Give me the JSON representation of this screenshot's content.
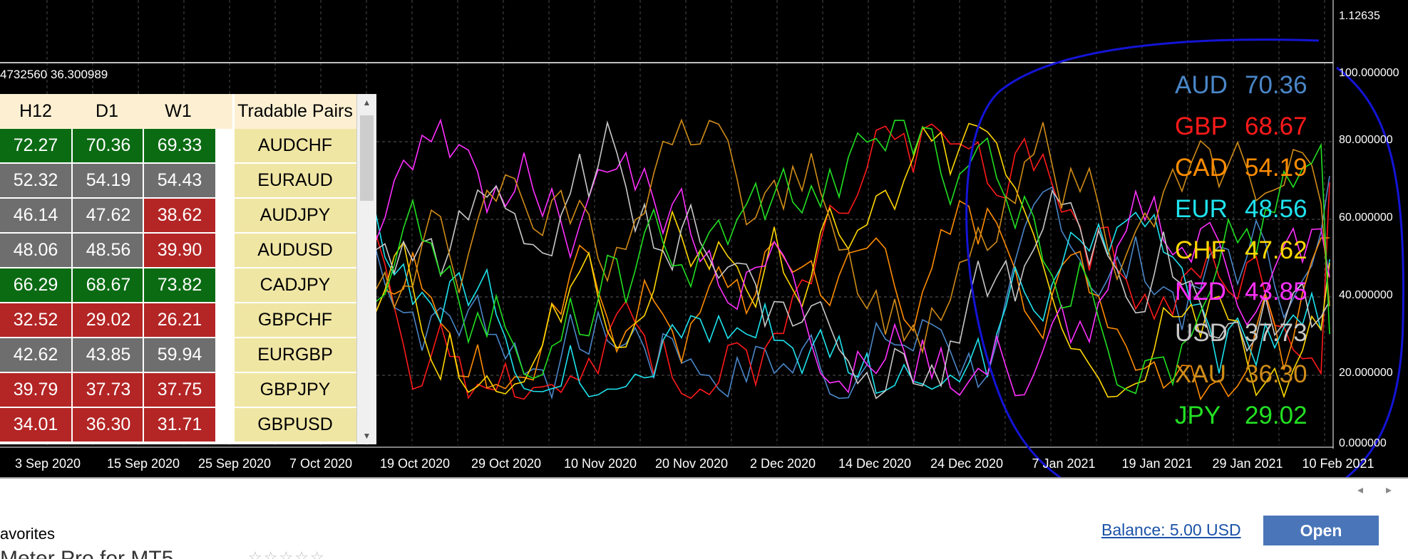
{
  "indicator_label": "4732560 36.300989",
  "table": {
    "headers": [
      "H12",
      "D1",
      "W1",
      "Tradable Pairs"
    ],
    "rows": [
      {
        "h12": "72.27",
        "d1": "70.36",
        "w1": "69.33",
        "pair": "AUDCHF",
        "colors": [
          "#0a6b13",
          "#0a6b13",
          "#0a6b13"
        ]
      },
      {
        "h12": "52.32",
        "d1": "54.19",
        "w1": "54.43",
        "pair": "EURAUD",
        "colors": [
          "#6e6e6e",
          "#6e6e6e",
          "#6e6e6e"
        ]
      },
      {
        "h12": "46.14",
        "d1": "47.62",
        "w1": "38.62",
        "pair": "AUDJPY",
        "colors": [
          "#6e6e6e",
          "#6e6e6e",
          "#b42525"
        ]
      },
      {
        "h12": "48.06",
        "d1": "48.56",
        "w1": "39.90",
        "pair": "AUDUSD",
        "colors": [
          "#6e6e6e",
          "#6e6e6e",
          "#b42525"
        ]
      },
      {
        "h12": "66.29",
        "d1": "68.67",
        "w1": "73.82",
        "pair": "CADJPY",
        "colors": [
          "#0a6b13",
          "#0a6b13",
          "#0a6b13"
        ]
      },
      {
        "h12": "32.52",
        "d1": "29.02",
        "w1": "26.21",
        "pair": "GBPCHF",
        "colors": [
          "#b42525",
          "#b42525",
          "#b42525"
        ]
      },
      {
        "h12": "42.62",
        "d1": "43.85",
        "w1": "59.94",
        "pair": "EURGBP",
        "colors": [
          "#6e6e6e",
          "#6e6e6e",
          "#6e6e6e"
        ]
      },
      {
        "h12": "39.79",
        "d1": "37.73",
        "w1": "37.75",
        "pair": "GBPJPY",
        "colors": [
          "#b42525",
          "#b42525",
          "#b42525"
        ]
      },
      {
        "h12": "34.01",
        "d1": "36.30",
        "w1": "31.71",
        "pair": "GBPUSD",
        "colors": [
          "#b42525",
          "#b42525",
          "#b42525"
        ]
      }
    ]
  },
  "y_axis": [
    "1.12635",
    "100.000000",
    "80.000000",
    "60.000000",
    "40.000000",
    "20.000000",
    "0.000000"
  ],
  "x_axis": [
    "3 Sep 2020",
    "15 Sep 2020",
    "25 Sep 2020",
    "7 Oct 2020",
    "19 Oct 2020",
    "29 Oct 2020",
    "10 Nov 2020",
    "20 Nov 2020",
    "2 Dec 2020",
    "14 Dec 2020",
    "24 Dec 2020",
    "7 Jan 2021",
    "19 Jan 2021",
    "29 Jan 2021",
    "10 Feb 2021"
  ],
  "legend": [
    {
      "ccy": "AUD",
      "val": "70.36",
      "color": "#4a86c8"
    },
    {
      "ccy": "GBP",
      "val": "68.67",
      "color": "#ff1a1a"
    },
    {
      "ccy": "CAD",
      "val": "54.19",
      "color": "#ff8c00"
    },
    {
      "ccy": "EUR",
      "val": "48.56",
      "color": "#1ee3ee"
    },
    {
      "ccy": "CHF",
      "val": "47.62",
      "color": "#ffd700"
    },
    {
      "ccy": "NZD",
      "val": "43.85",
      "color": "#ff30ff"
    },
    {
      "ccy": "USD",
      "val": "37.73",
      "color": "#c8c8c8"
    },
    {
      "ccy": "XAU",
      "val": "36.30",
      "color": "#d08c18"
    },
    {
      "ccy": "JPY",
      "val": "29.02",
      "color": "#22e022"
    }
  ],
  "bottom": {
    "favorites": "avorites",
    "balance": "Balance: 5.00 USD",
    "open": "Open",
    "title": "Meter Pro for MT5"
  }
}
